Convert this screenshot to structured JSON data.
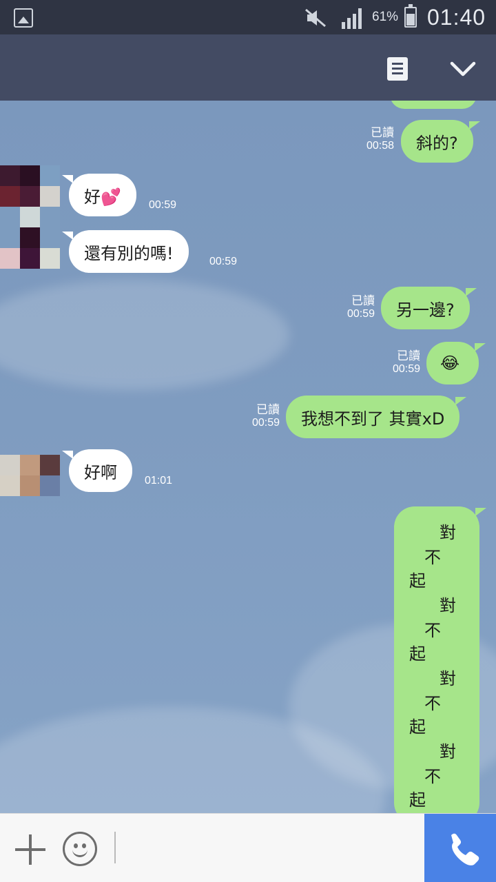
{
  "status_bar": {
    "battery_percent": "61%",
    "time": "01:40",
    "icons": [
      "gallery-icon",
      "mute-icon",
      "signal-icon",
      "battery-icon"
    ]
  },
  "header": {
    "icons": [
      "note-icon",
      "chevron-down-icon"
    ]
  },
  "messages": {
    "m1": {
      "text": "斜的?",
      "read": "已讀",
      "time": "00:58",
      "side": "sent"
    },
    "m2": {
      "text": "好💕",
      "time": "00:59",
      "side": "received"
    },
    "m3": {
      "text": "還有別的嗎!",
      "time": "00:59",
      "side": "received"
    },
    "m4": {
      "text": "另一邊?",
      "read": "已讀",
      "time": "00:59",
      "side": "sent"
    },
    "m5": {
      "text": "😂",
      "read": "已讀",
      "time": "00:59",
      "side": "sent"
    },
    "m6": {
      "text": "我想不到了 其實xD",
      "read": "已讀",
      "time": "00:59",
      "side": "sent"
    },
    "m7": {
      "text": "好啊",
      "time": "01:01",
      "side": "received"
    },
    "m8": {
      "chars": [
        "對",
        "不",
        "起",
        "對",
        "不",
        "起",
        "對",
        "不",
        "起",
        "對",
        "不",
        "起"
      ],
      "side": "sent"
    }
  },
  "input_bar": {
    "icons": [
      "plus-icon",
      "emoji-icon",
      "phone-icon"
    ]
  },
  "colors": {
    "sent_bubble": "#a6e58a",
    "received_bubble": "#ffffff",
    "header": "#434b63",
    "status_bar": "#2f3443",
    "call_button": "#4a82e6"
  }
}
